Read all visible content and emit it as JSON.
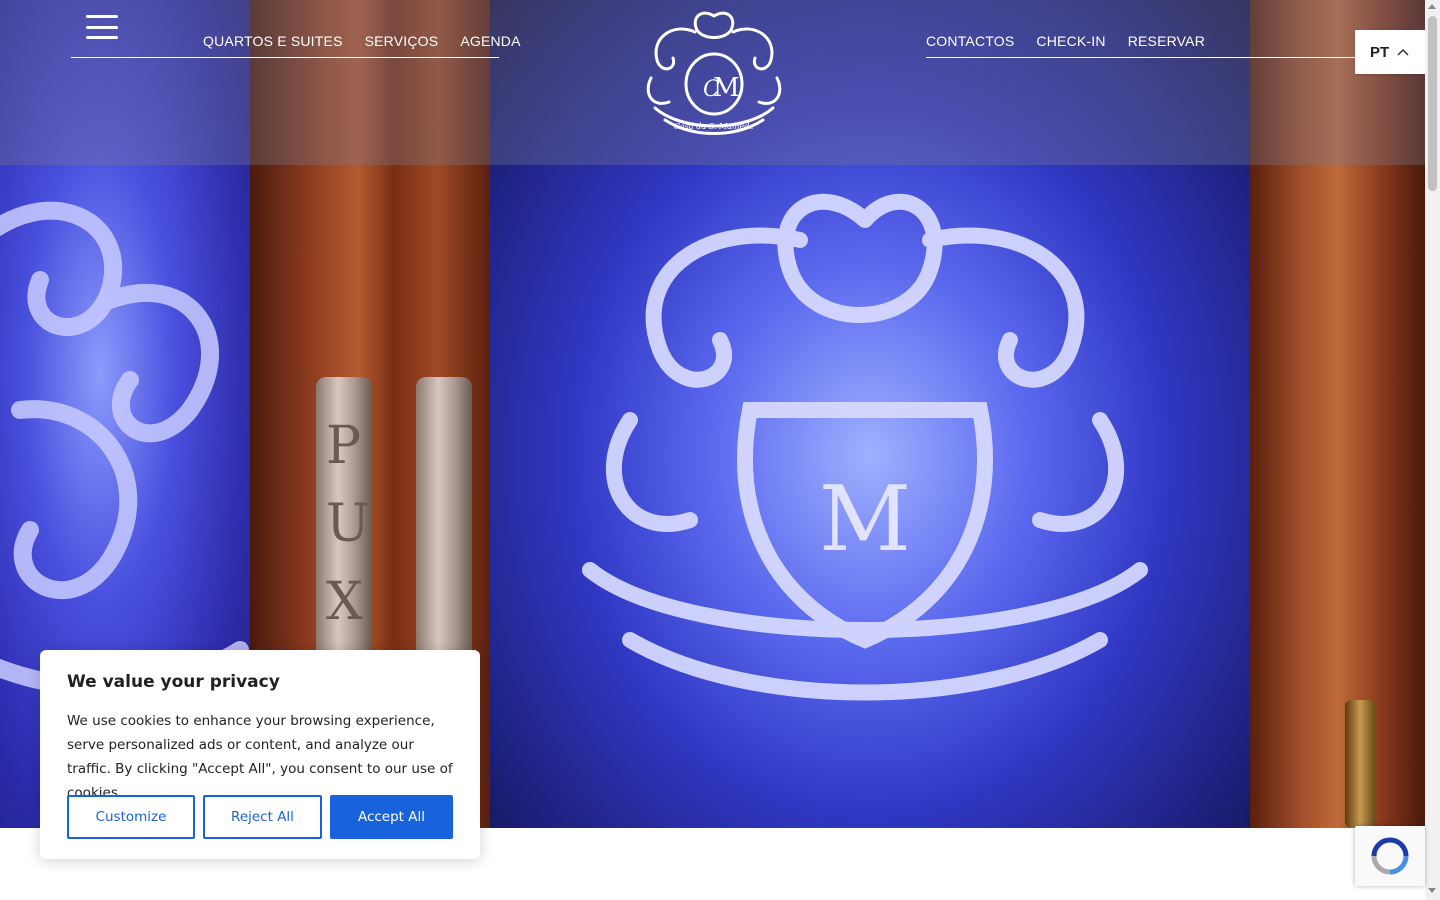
{
  "nav": {
    "left": [
      "QUARTOS E SUITES",
      "SERVIÇOS",
      "AGENDA"
    ],
    "right": [
      "CONTACTOS",
      "CHECK-IN",
      "RESERVAR"
    ]
  },
  "logo": {
    "text": "Casa da S. Mamede",
    "icon": "crest-logo"
  },
  "language": {
    "code": "PT",
    "icon": "chevron-up-icon"
  },
  "menu": {
    "icon": "hamburger-menu-icon"
  },
  "hero": {
    "door_sign": "PUX"
  },
  "cookie_banner": {
    "title": "We value your privacy",
    "text": "We use cookies to enhance your browsing experience, serve personalized ads or content, and analyze our traffic. By clicking \"Accept All\", you consent to our use of cookies.",
    "customize_label": "Customize",
    "reject_label": "Reject All",
    "accept_label": "Accept All",
    "accent_color": "#1863dc"
  },
  "recaptcha": {
    "icon": "recaptcha-icon"
  }
}
